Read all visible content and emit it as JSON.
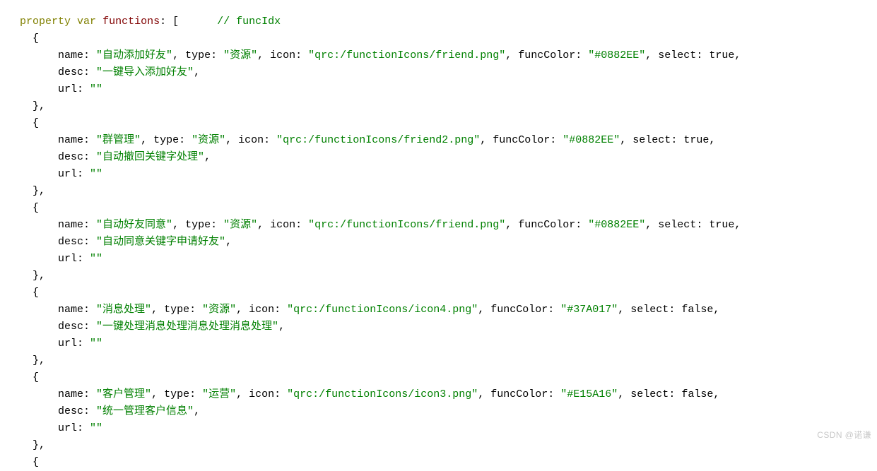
{
  "editor": {
    "language": "qml",
    "background_color": "#FFFFFF",
    "token_colors": {
      "keyword": "#808000",
      "identifier": "#800000",
      "string": "#008000",
      "comment": "#008000",
      "plain": "#000000"
    }
  },
  "watermark": {
    "text": "CSDN @诺谦"
  },
  "code": {
    "declaration": {
      "keyword_property": "property",
      "keyword_var": "var",
      "identifier": "functions",
      "colon": ": ",
      "open_bracket": "[",
      "comment": "// funcIdx"
    },
    "indent": {
      "brace": "    ",
      "property": "        "
    },
    "punct": {
      "open_brace": "{",
      "close_brace_comma": "},",
      "comma_space": ", ",
      "quote": "\"",
      "colon_space": ": ",
      "trailing_comma": ","
    },
    "keys": {
      "name": "name",
      "type": "type",
      "icon": "icon",
      "funcColor": "funcColor",
      "select": "select",
      "desc": "desc",
      "url": "url"
    },
    "entries": [
      {
        "name": "自动添加好友",
        "type": "资源",
        "icon": "qrc:/functionIcons/friend.png",
        "funcColor": "#0882EE",
        "select": "true",
        "desc": "一键导入添加好友",
        "url": ""
      },
      {
        "name": "群管理",
        "type": "资源",
        "icon": "qrc:/functionIcons/friend2.png",
        "funcColor": "#0882EE",
        "select": "true",
        "desc": "自动撤回关键字处理",
        "url": ""
      },
      {
        "name": "自动好友同意",
        "type": "资源",
        "icon": "qrc:/functionIcons/friend.png",
        "funcColor": "#0882EE",
        "select": "true",
        "desc": "自动同意关键字申请好友",
        "url": ""
      },
      {
        "name": "消息处理",
        "type": "资源",
        "icon": "qrc:/functionIcons/icon4.png",
        "funcColor": "#37A017",
        "select": "false",
        "desc": "一键处理消息处理消息处理消息处理",
        "url": ""
      },
      {
        "name": "客户管理",
        "type": "运营",
        "icon": "qrc:/functionIcons/icon3.png",
        "funcColor": "#E15A16",
        "select": "false",
        "desc": "统一管理客户信息",
        "url": ""
      }
    ],
    "trailing_open_brace": "{"
  }
}
